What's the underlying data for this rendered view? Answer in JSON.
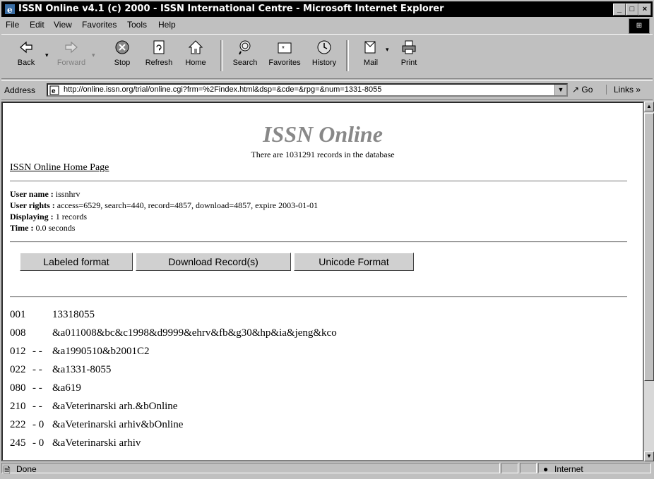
{
  "window": {
    "title": "ISSN Online v4.1 (c) 2000 - ISSN International Centre - Microsoft Internet Explorer"
  },
  "menu": [
    "File",
    "Edit",
    "View",
    "Favorites",
    "Tools",
    "Help"
  ],
  "toolbar": {
    "back": "Back",
    "forward": "Forward",
    "stop": "Stop",
    "refresh": "Refresh",
    "home": "Home",
    "search": "Search",
    "favorites": "Favorites",
    "history": "History",
    "mail": "Mail",
    "print": "Print"
  },
  "address": {
    "label": "Address",
    "url": "http://online.issn.org/trial/online.cgi?frm=%2Findex.html&dsp=&cde=&rpg=&num=1331-8055",
    "go": "Go",
    "links": "Links"
  },
  "page": {
    "title": "ISSN Online",
    "subtitle": "There are 1031291 records in the database",
    "home_link": "ISSN Online Home Page",
    "user_name_label": "User name :",
    "user_name": "issnhrv",
    "user_rights_label": "User rights :",
    "user_rights": "access=6529, search=440, record=4857, download=4857, expire 2003-01-01",
    "displaying_label": "Displaying :",
    "displaying": "1 records",
    "time_label": "Time :",
    "time": "0.0 seconds",
    "buttons": {
      "labeled": "Labeled format",
      "download": "Download Record(s)",
      "unicode": "Unicode Format"
    },
    "records": [
      {
        "tag": "001",
        "ind": "",
        "value": "13318055"
      },
      {
        "tag": "008",
        "ind": "",
        "value": "&a011008&bc&c1998&d9999&ehrv&fb&g30&hp&ia&jeng&kco"
      },
      {
        "tag": "012",
        "ind": "- -",
        "value": "&a1990510&b2001C2"
      },
      {
        "tag": "022",
        "ind": "- -",
        "value": "&a1331-8055"
      },
      {
        "tag": "080",
        "ind": "- -",
        "value": "&a619"
      },
      {
        "tag": "210",
        "ind": "- -",
        "value": "&aVeterinarski arh.&bOnline"
      },
      {
        "tag": "222",
        "ind": "- 0",
        "value": "&aVeterinarski arhiv&bOnline"
      },
      {
        "tag": "245",
        "ind": "- 0",
        "value": "&aVeterinarski arhiv"
      }
    ]
  },
  "status": {
    "text": "Done",
    "zone": "Internet"
  }
}
